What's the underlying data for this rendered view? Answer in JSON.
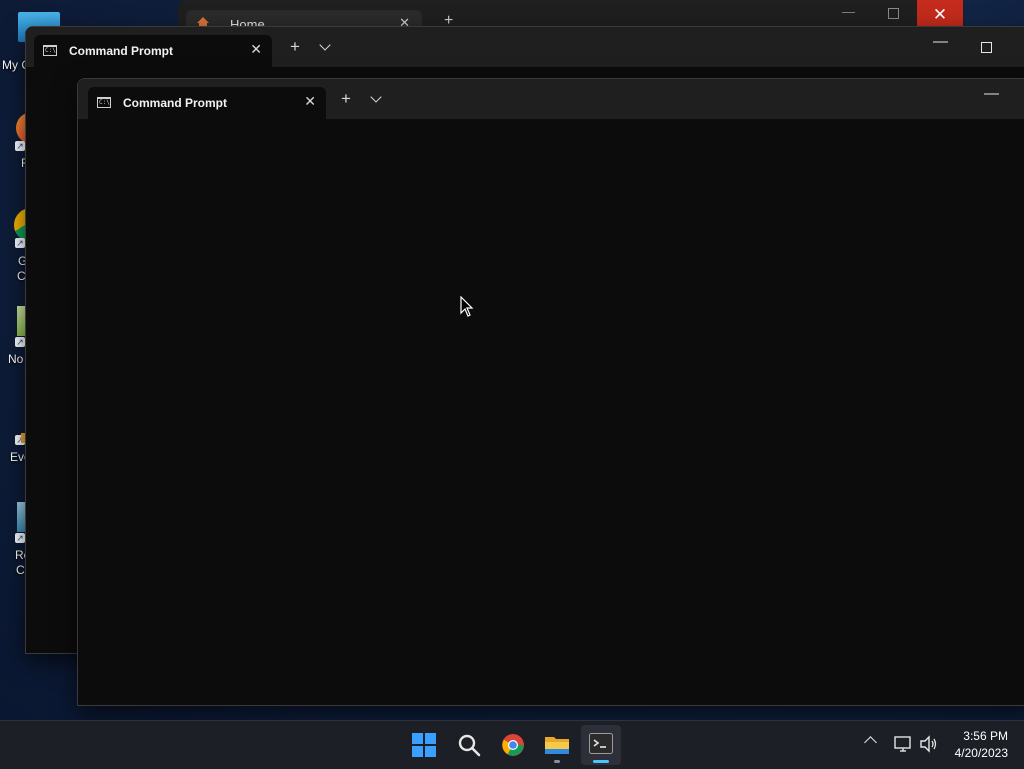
{
  "desktop": {
    "icons": [
      {
        "label": "My C",
        "icon": "computer-icon"
      },
      {
        "label": "F",
        "icon": "firefox-icon"
      },
      {
        "label_line1": "G",
        "label_line2": "C",
        "icon": "chrome-icon"
      },
      {
        "label": "No",
        "icon": "notepad-icon"
      },
      {
        "label": "Eve",
        "icon": "event-icon"
      },
      {
        "label_line1": "Re",
        "label_line2": "C",
        "icon": "recycle-bin-icon"
      }
    ]
  },
  "background_window": {
    "tab_label": "Home",
    "close_color": "#c42b1c"
  },
  "terminal_back": {
    "tab_label": "Command Prompt"
  },
  "terminal_front": {
    "tab_label": "Command Prompt"
  },
  "taskbar": {
    "apps": [
      "start-icon",
      "search-icon",
      "chrome-icon",
      "file-explorer-icon",
      "terminal-icon"
    ],
    "active_app": "terminal-icon",
    "accent_color": "#4cc2ff",
    "time": "3:56 PM",
    "date": "4/20/2023"
  }
}
